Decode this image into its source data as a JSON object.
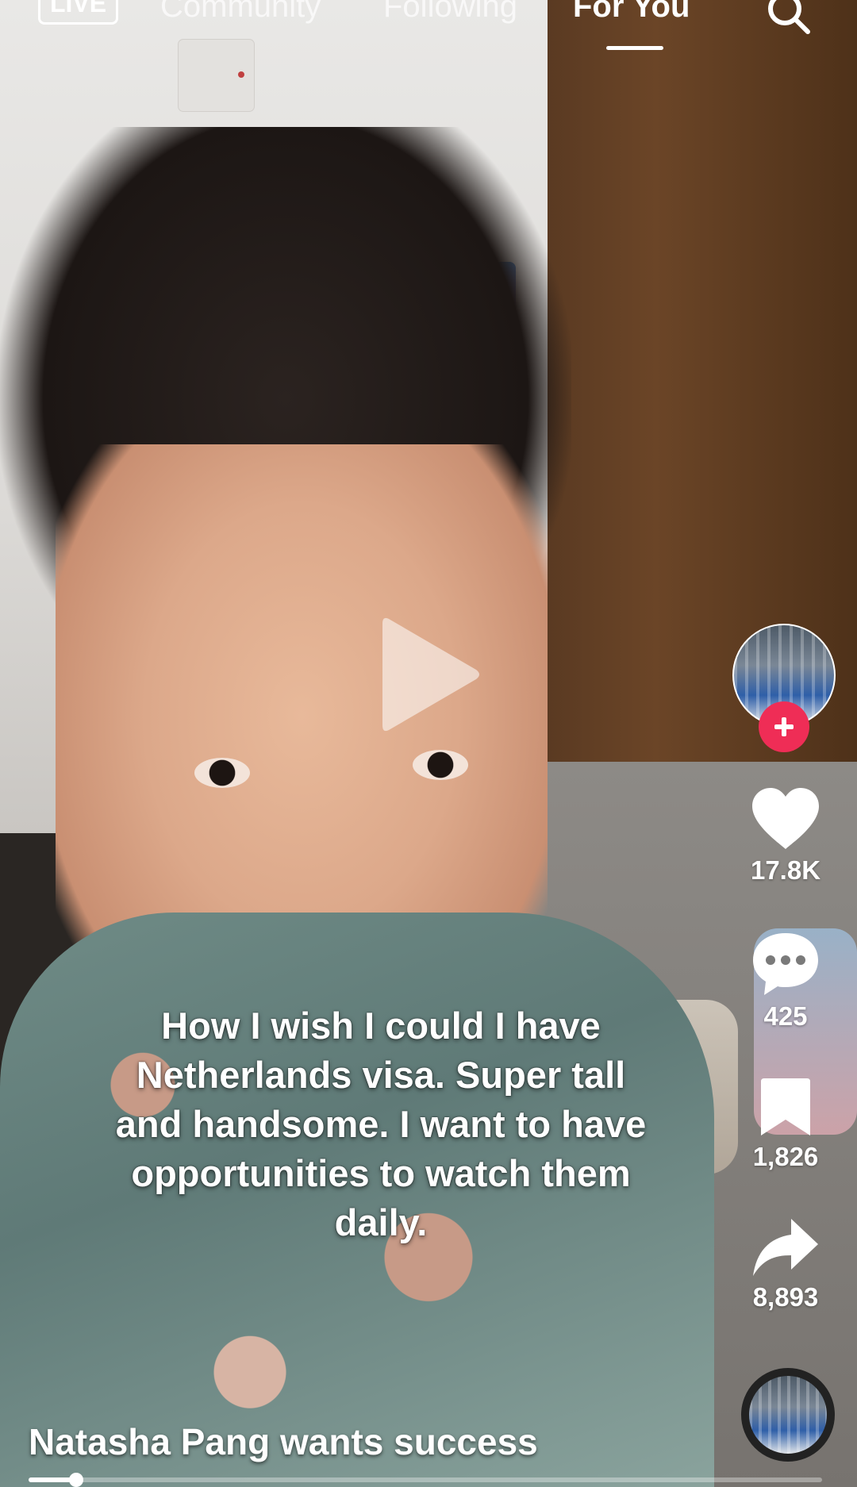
{
  "top_nav": {
    "live_label": "LIVE",
    "tabs": [
      "Community",
      "Following",
      "For You"
    ],
    "active_tab": "For You"
  },
  "overlay_text": "How I wish I could I have Netherlands visa. Super tall and handsome. I want to have opportunities to watch them daily.",
  "actions": {
    "likes": "17.8K",
    "comments": "425",
    "saves": "1,826",
    "shares": "8,893"
  },
  "creator_line": "Natasha Pang wants success",
  "progress_fraction": 0.06,
  "colors": {
    "follow_accent": "#ef2d56",
    "text": "#ffffff"
  },
  "icons": [
    "search-icon",
    "play-icon",
    "plus-icon",
    "heart-icon",
    "comment-icon",
    "bookmark-icon",
    "share-icon"
  ]
}
